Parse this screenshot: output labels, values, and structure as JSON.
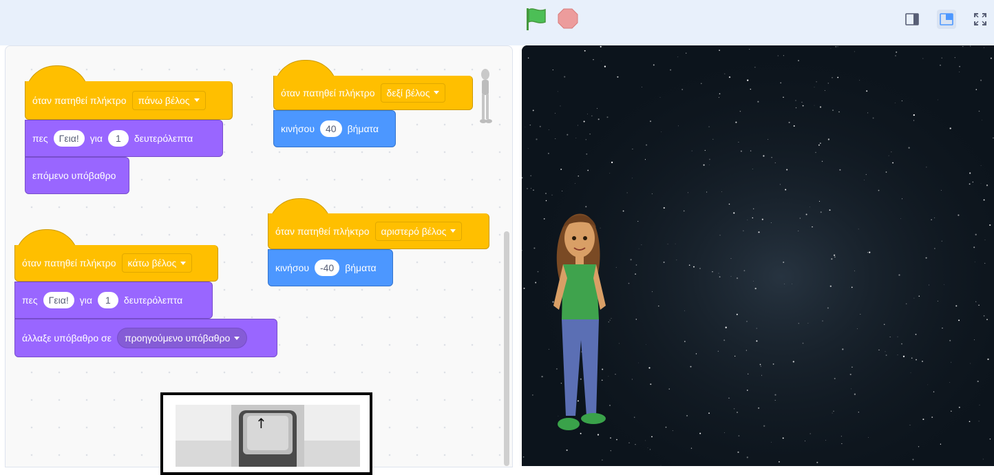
{
  "toolbar": {
    "green_flag": "green-flag",
    "stop": "stop-sign",
    "modes": [
      "small-stage-icon",
      "normal-stage-icon",
      "fullscreen-icon"
    ]
  },
  "colors": {
    "event": "#ffbf00",
    "looks": "#9966ff",
    "motion": "#4c97ff",
    "topbar": "#e8f0fb",
    "stage_bg": "#0b1219"
  },
  "scripts": {
    "up": {
      "hat_label": "όταν πατηθεί πλήκτρο",
      "key": "πάνω βέλος",
      "say_word": "πες",
      "say_text": "Γεια!",
      "for_word": "για",
      "secs": "1",
      "secs_word": "δευτερόλεπτα",
      "next_backdrop": "επόμενο υπόβαθρο"
    },
    "down": {
      "hat_label": "όταν πατηθεί πλήκτρο",
      "key": "κάτω βέλος",
      "say_word": "πες",
      "say_text": "Γεια!",
      "for_word": "για",
      "secs": "1",
      "secs_word": "δευτερόλεπτα",
      "switch_label": "άλλαξε υπόβαθρο σε",
      "switch_value": "προηγούμενο υπόβαθρο"
    },
    "right": {
      "hat_label": "όταν πατηθεί πλήκτρο",
      "key": "δεξί βέλος",
      "move_word": "κινήσου",
      "steps": "40",
      "steps_word": "βήματα"
    },
    "left": {
      "hat_label": "όταν πατηθεί πλήκτρο",
      "key": "αριστερό βέλος",
      "move_word": "κινήσου",
      "steps": "-40",
      "steps_word": "βήματα"
    }
  },
  "key_illustration": {
    "glyph": "↑"
  }
}
